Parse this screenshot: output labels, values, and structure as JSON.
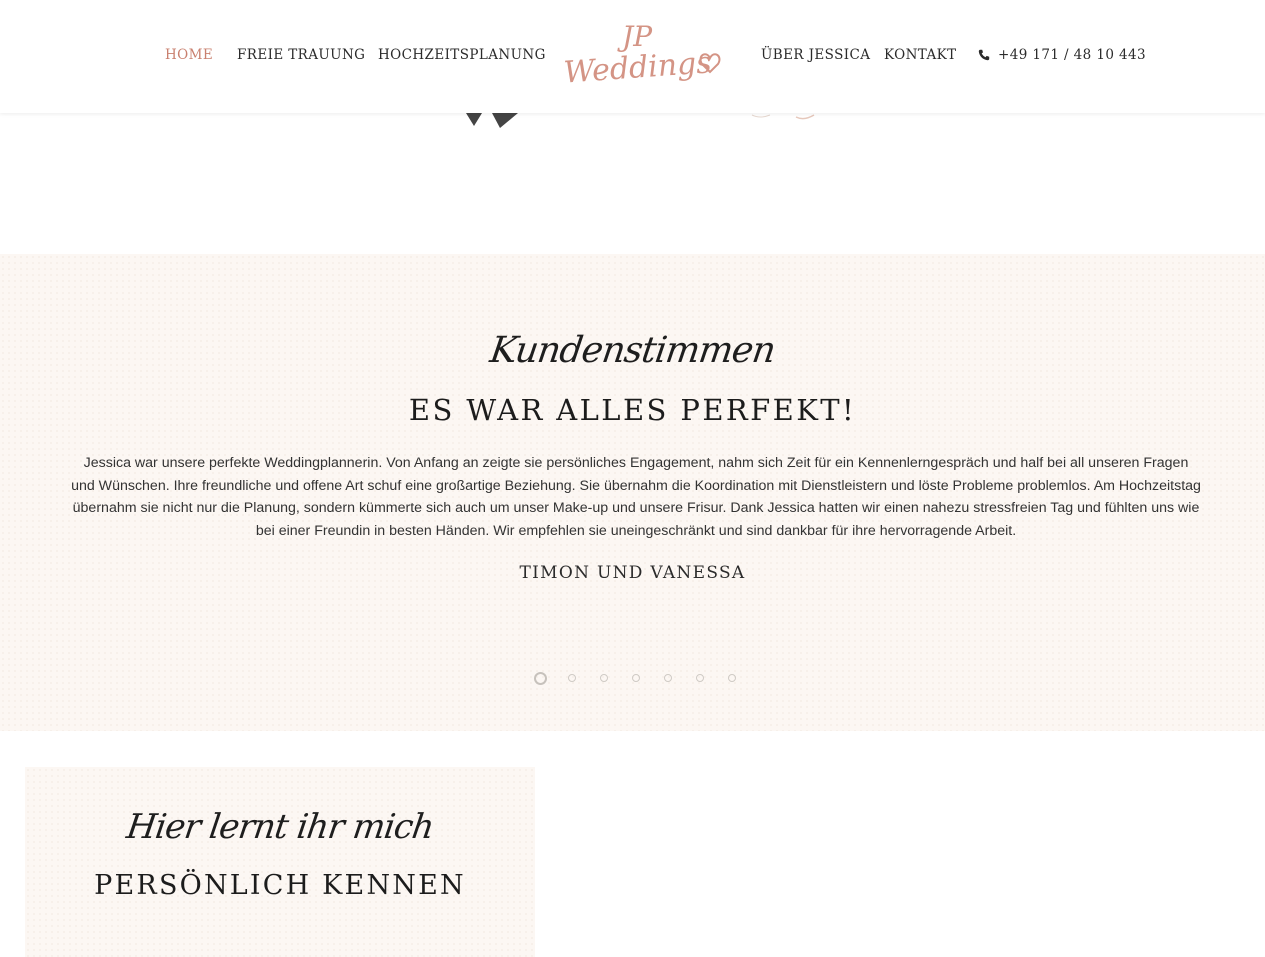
{
  "nav": {
    "left": [
      {
        "label": "HOME",
        "active": true
      },
      {
        "label": "FREIE TRAUUNG",
        "active": false
      },
      {
        "label": "HOCHZEITSPLANUNG",
        "active": false
      }
    ],
    "right": [
      {
        "label": "ÜBER JESSICA",
        "active": false
      },
      {
        "label": "KONTAKT",
        "active": false
      }
    ],
    "phone": "+49 171 / 48 10 443",
    "phone_icon": "phone-icon",
    "active_color": "#c9806f"
  },
  "logo": {
    "monogram": "JP",
    "wordmark": "Weddings",
    "color": "#d49485"
  },
  "testimonials": {
    "script_title": "Kundenstimmen",
    "heading": "ES WAR ALLES PERFEKT!",
    "body": "Jessica war unsere perfekte Weddingplannerin. Von Anfang an zeigte sie persönliches Engagement, nahm sich Zeit für ein Kennenlerngespräch und half bei all unseren Fragen und Wünschen. Ihre freundliche und offene Art schuf eine großartige Beziehung. Sie übernahm die Koordination mit Dienstleistern und löste Probleme problemlos. Am Hochzeitstag übernahm sie nicht nur die Planung, sondern kümmerte sich auch um unser Make-up und unsere Frisur. Dank Jessica hatten wir einen nahezu stressfreien Tag und fühlten uns wie bei einer Freundin in besten Händen. Wir empfehlen sie uneingeschränkt und sind dankbar für ihre hervorragende Arbeit.",
    "author": "TIMON UND VANESSA",
    "slides_total": 7,
    "active_slide": 1,
    "background": "#fcf7f3"
  },
  "about": {
    "script_title": "Hier lernt ihr mich",
    "heading": "PERSÖNLICH KENNEN"
  }
}
